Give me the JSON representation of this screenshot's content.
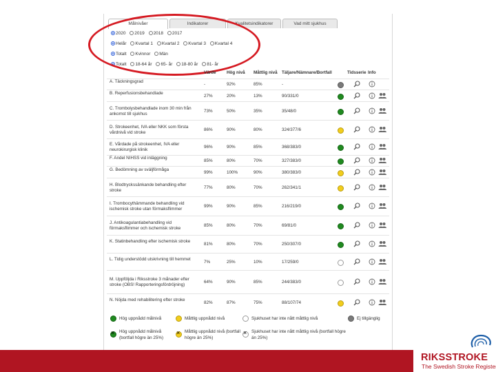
{
  "tabs": [
    "Målnivåer",
    "Indikatorer",
    "Kvalitetsindikatorer",
    "Vad mitt sjukhus"
  ],
  "filters": {
    "years": [
      "2020",
      "2019",
      "2018",
      "2017"
    ],
    "periods": [
      "Helår",
      "Kvartal 1",
      "Kvartal 2",
      "Kvartal 3",
      "Kvartal 4"
    ],
    "sex": [
      "Totalt",
      "Kvinnor",
      "Män"
    ],
    "ages": [
      "Totalt",
      "18-64 år",
      "65- år",
      "18-80 år",
      "81- år"
    ]
  },
  "columns": {
    "value": "Värde",
    "high": "Hög nivå",
    "moderate": "Måttlig nivå",
    "counts": "Täljare/Nämnare/Bortfall",
    "timeseries": "Tidsserie",
    "info": "Info"
  },
  "rows": [
    {
      "name": "A. Täckningsgrad",
      "value": "-",
      "high": "92%",
      "moderate": "85%",
      "counts": "-",
      "status": "gray"
    },
    {
      "name": "B. Reperfusionsbehandlade",
      "value": "27%",
      "high": "20%",
      "moderate": "13%",
      "counts": "90/331/0",
      "status": "green"
    },
    {
      "name": "C. Trombolysbehandlade inom 30 min från ankomst till sjukhus",
      "value": "73%",
      "high": "50%",
      "moderate": "35%",
      "counts": "35/48/0",
      "status": "green"
    },
    {
      "name": "D. Strokeenhet, IVA eller NKK som första vårdnivå vid stroke",
      "value": "86%",
      "high": "90%",
      "moderate": "80%",
      "counts": "324/377/6",
      "status": "yellow"
    },
    {
      "name": "E. Vårdade på strokeenhet, IVA eller neurokirurgisk klinik",
      "value": "96%",
      "high": "90%",
      "moderate": "85%",
      "counts": "368/383/0",
      "status": "green"
    },
    {
      "name": "F. Andel NIHSS vid inläggning",
      "value": "85%",
      "high": "80%",
      "moderate": "70%",
      "counts": "327/383/0",
      "status": "green"
    },
    {
      "name": "G. Bedömning av sväljförmåga",
      "value": "99%",
      "high": "100%",
      "moderate": "90%",
      "counts": "380/383/0",
      "status": "yellow"
    },
    {
      "name": "H. Blodtryckssänkande behandling efter stroke",
      "value": "77%",
      "high": "80%",
      "moderate": "70%",
      "counts": "262/341/1",
      "status": "yellow"
    },
    {
      "name": "I. Trombocythämmande behandling vid ischemisk stroke utan förmaksflimmer",
      "value": "99%",
      "high": "90%",
      "moderate": "85%",
      "counts": "216/219/0",
      "status": "green"
    },
    {
      "name": "J. Antikoagulantiabehandling vid förmaksflimmer och ischemisk stroke",
      "value": "85%",
      "high": "80%",
      "moderate": "70%",
      "counts": "69/81/0",
      "status": "green"
    },
    {
      "name": "K. Statinbehandling efter ischemisk stroke",
      "value": "81%",
      "high": "80%",
      "moderate": "70%",
      "counts": "250/307/0",
      "status": "green"
    },
    {
      "name": "L. Tidig understödd utskrivning till hemmet",
      "value": "7%",
      "high": "25%",
      "moderate": "10%",
      "counts": "17/259/0",
      "status": "white"
    },
    {
      "name": "M. Uppföljda i Riksstroke 3 månader efter stroke (OBS! Rapporteringsfördröjning)",
      "value": "64%",
      "high": "90%",
      "moderate": "85%",
      "counts": "244/383/0",
      "status": "white"
    },
    {
      "name": "N. Nöjda med rehabilitering efter stroke",
      "value": "82%",
      "high": "87%",
      "moderate": "75%",
      "counts": "88/107/74",
      "status": "yellow"
    }
  ],
  "legend": {
    "green": "Hög uppnådd målnivå",
    "yellow": "Måttlig uppnådd nivå",
    "white": "Sjukhuset har inte nått måttlig nivå",
    "gray": "Ej tillgänglig",
    "green_x": "Hög uppnådd målnivå (bortfall högre än 25%)",
    "yellow_x": "Måttlig uppnådd nivå (bortfall högre än 25%)",
    "white_x": "Sjukhuset har inte nått måttlig nivå (bortfall högre än 25%)"
  },
  "brand": {
    "name": "RIKSSTROKE",
    "tagline": "The Swedish Stroke Register"
  },
  "colors": {
    "green": "#1f8a1f",
    "yellow": "#f2cd1c",
    "white": "#ffffff",
    "gray": "#7a7a7a",
    "brand_red": "#b01522",
    "highlight": "#d51a22"
  }
}
